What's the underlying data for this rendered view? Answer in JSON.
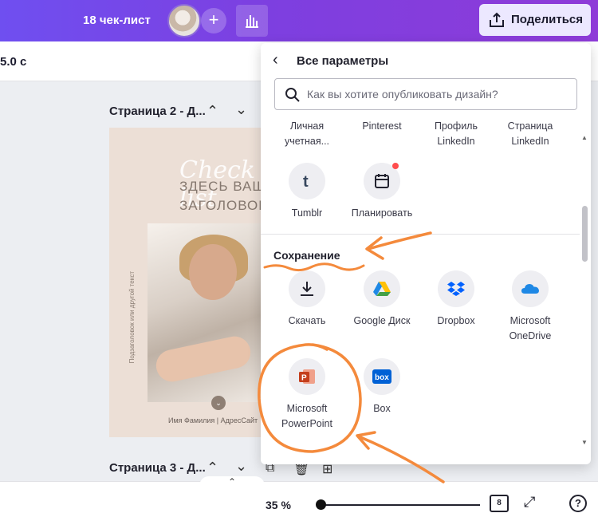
{
  "topbar": {
    "doc_title": "18 чек-лист",
    "add_label": "+",
    "share_label": "Поделиться"
  },
  "toolbar": {
    "duration": "5.0 с"
  },
  "canvas": {
    "page2_label": "Страница 2 - Д...",
    "page3_label": "Страница 3 - Д...",
    "design": {
      "script_text": "Check list",
      "heading_line1": "ЗДЕСЬ ВАШ",
      "heading_line2": "ЗАГОЛОВОК",
      "vertical_text": "Подзаголовок или другой текст",
      "footer_text": "Имя Фамилия | АдресСайт"
    }
  },
  "share_panel": {
    "title": "Все параметры",
    "search_placeholder": "Как вы хотите опубликовать дизайн?",
    "row_partial": [
      {
        "label": "Личная учетная..."
      },
      {
        "label": "Pinterest"
      },
      {
        "label": "Профиль LinkedIn"
      },
      {
        "label": "Страница LinkedIn"
      }
    ],
    "row_social": [
      {
        "label": "Tumblr",
        "icon": "tumblr-icon"
      },
      {
        "label": "Планировать",
        "icon": "calendar-icon"
      }
    ],
    "save_section": {
      "title": "Сохранение",
      "items": [
        {
          "label": "Скачать",
          "icon": "download-icon"
        },
        {
          "label": "Google Диск",
          "icon": "google-drive-icon"
        },
        {
          "label": "Dropbox",
          "icon": "dropbox-icon"
        },
        {
          "label": "Microsoft OneDrive",
          "icon": "onedrive-icon"
        },
        {
          "label": "Microsoft PowerPoint",
          "icon": "powerpoint-icon"
        },
        {
          "label": "Box",
          "icon": "box-icon"
        }
      ]
    }
  },
  "bottombar": {
    "zoom": "35 %",
    "zoom_level": 0.02,
    "pages_count": "8",
    "help": "?"
  },
  "colors": {
    "brand_gradient_start": "#6f4ff0",
    "brand_gradient_end": "#8e3bd8",
    "annotation": "#f48a3c"
  }
}
